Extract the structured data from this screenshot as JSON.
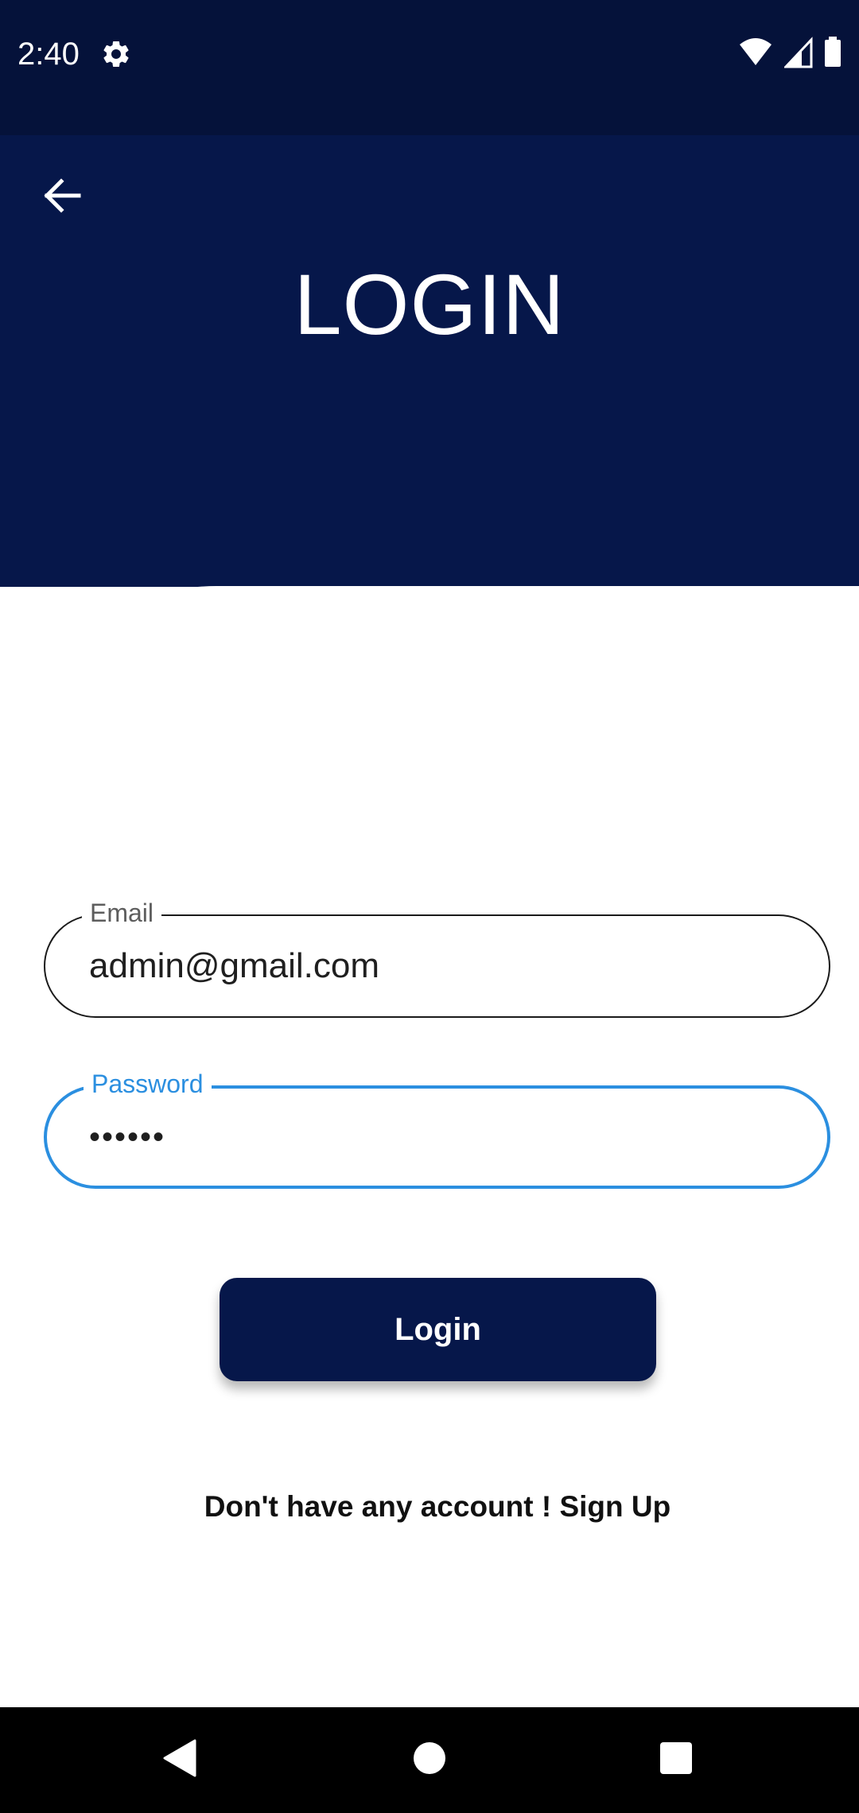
{
  "status_bar": {
    "time": "2:40",
    "icons": [
      "gear-icon",
      "wifi-icon",
      "signal-icon",
      "battery-icon"
    ]
  },
  "header": {
    "back_icon": "arrow-left-icon",
    "title": "LOGIN"
  },
  "form": {
    "email": {
      "label": "Email",
      "value": "admin@gmail.com"
    },
    "password": {
      "label": "Password",
      "value": "••••••"
    },
    "login_button": "Login",
    "signup_text": "Don't have any account ! Sign Up"
  },
  "nav_bar": {
    "icons": [
      "back-triangle-icon",
      "home-circle-icon",
      "recents-square-icon"
    ]
  },
  "colors": {
    "status_bar": "#05123a",
    "header": "#06174a",
    "accent": "#2b8fe0",
    "button": "#06174a"
  }
}
